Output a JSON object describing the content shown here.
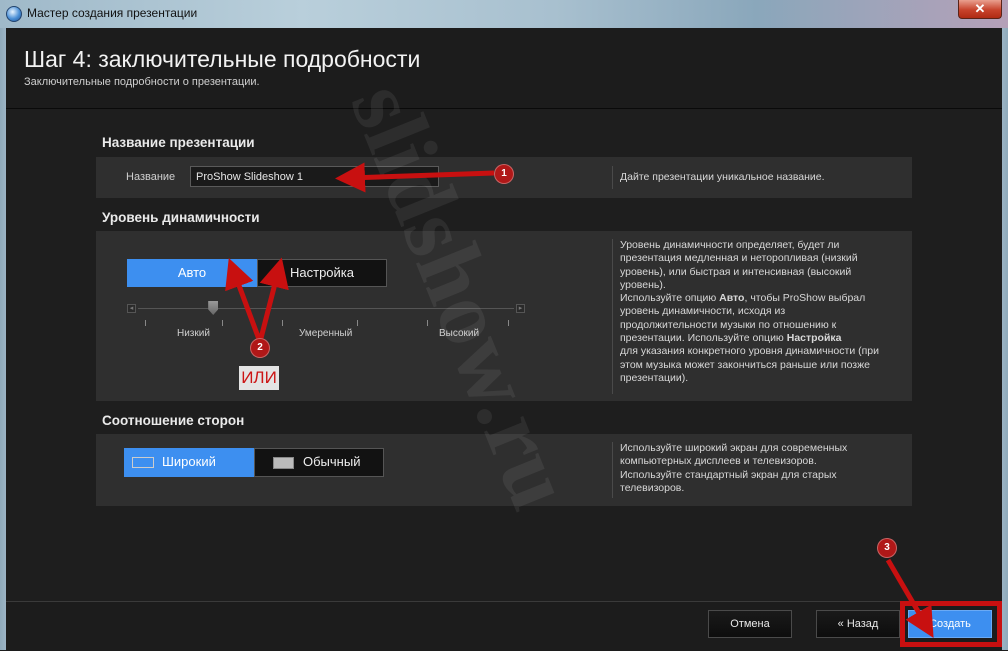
{
  "window": {
    "title": "Мастер создания презентации",
    "close_glyph": "✕"
  },
  "header": {
    "title": "Шаг 4: заключительные подробности",
    "subtitle": "Заключительные подробности о презентации."
  },
  "name_section": {
    "title": "Название презентации",
    "label": "Название",
    "value": "ProShow Slideshow 1",
    "help": "Дайте презентации уникальное название."
  },
  "dynamics_section": {
    "title": "Уровень динамичности",
    "options": [
      "Авто",
      "Настройка"
    ],
    "selected": "Авто",
    "slider": {
      "labels": [
        "Низкий",
        "Умеренный",
        "Высокий"
      ],
      "level": 0.2
    },
    "help_lines": [
      "Уровень динамичности определяет, будет ли",
      "презентация медленная и неторопливая (низкий",
      "уровень), или быстрая и интенсивная (высокий",
      "уровень)."
    ],
    "help_auto_prefix": "Используйте опцию ",
    "help_auto_bold": "Авто",
    "help_auto_suffix": ", чтобы ProShow выбрал",
    "help_lines2": [
      "уровень динамичности, исходя из",
      "продолжительности музыки по отношению к"
    ],
    "help_custom_prefix": "презентации. Используйте опцию ",
    "help_custom_bold": "Настройка",
    "help_lines3": [
      "для указания конкретного уровня динамичности (при",
      "этом музыка может закончиться раньше или позже",
      "презентации)."
    ]
  },
  "aspect_section": {
    "title": "Соотношение сторон",
    "options": [
      "Широкий",
      "Обычный"
    ],
    "selected": "Широкий",
    "help_lines": [
      "Используйте широкий экран для современных",
      "компьютерных дисплеев и телевизоров.",
      "Используйте стандартный экран для старых",
      "телевизоров."
    ]
  },
  "footer": {
    "cancel": "Отмена",
    "back": "« Назад",
    "create": "Создать"
  },
  "annotations": {
    "markers": [
      "1",
      "2",
      "3"
    ],
    "or_label": "ИЛИ",
    "watermark": "slidshow.ru",
    "color": "#c81010"
  },
  "colors": {
    "accent": "#3d8ff0",
    "panel": "#2f2f2f",
    "background": "#1e1e1e"
  }
}
